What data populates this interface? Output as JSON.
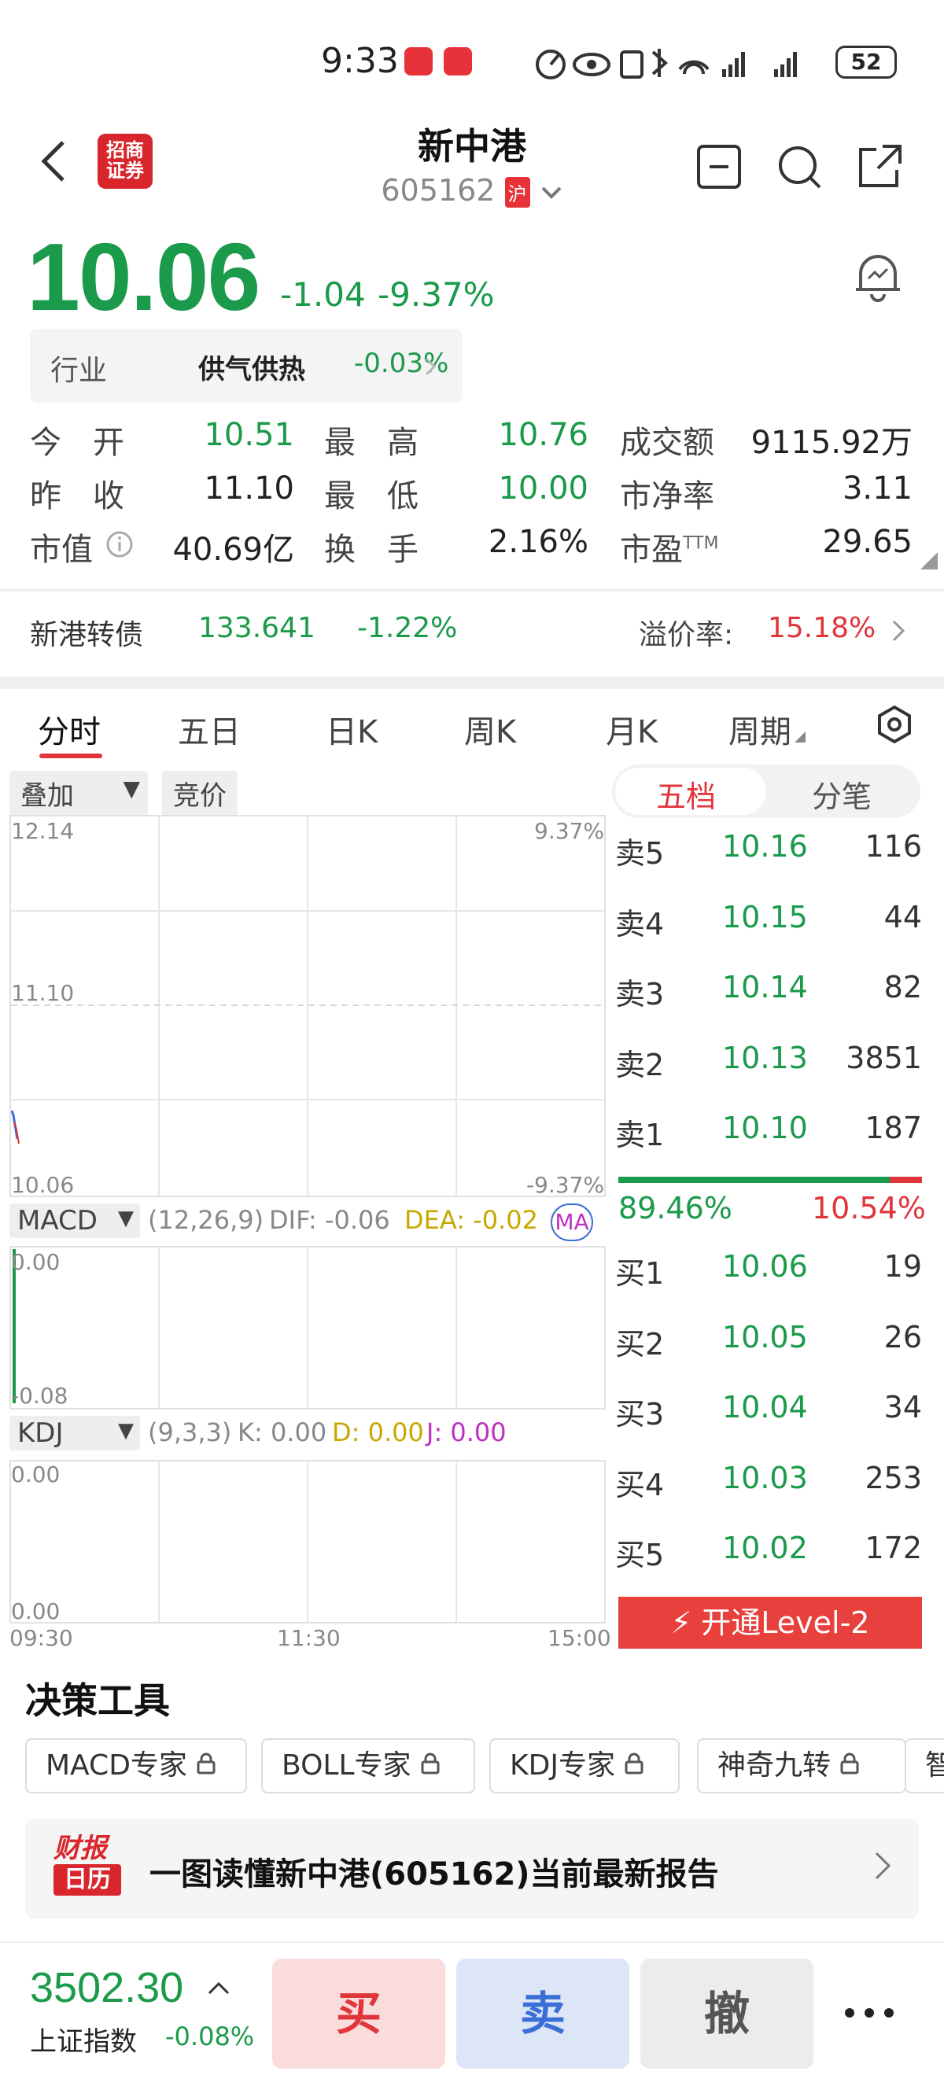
{
  "status_bar": {
    "time": "9:33",
    "battery": "52"
  },
  "header": {
    "title": "新中港",
    "code": "605162",
    "market_badge": "沪",
    "logo_text": "招商证券"
  },
  "quote": {
    "price": "10.06",
    "change": "-1.04",
    "change_pct": "-9.37%",
    "industry_label": "行业",
    "industry_name": "供气供热",
    "industry_change": "-0.03%",
    "rows": [
      [
        {
          "label": "今　开",
          "value": "10.51",
          "color": "#1a9a4a"
        },
        {
          "label": "最　高",
          "value": "10.76",
          "color": "#1a9a4a"
        },
        {
          "label": "成交额",
          "value": "9115.92万",
          "color": "#222222"
        }
      ],
      [
        {
          "label": "昨　收",
          "value": "11.10",
          "color": "#222222"
        },
        {
          "label": "最　低",
          "value": "10.00",
          "color": "#1a9a4a"
        },
        {
          "label": "市净率",
          "value": "3.11",
          "color": "#222222"
        }
      ],
      [
        {
          "label": "市值",
          "value": "40.69亿",
          "color": "#222222"
        },
        {
          "label": "换　手",
          "value": "2.16%",
          "color": "#222222"
        },
        {
          "label": "市盈TTM",
          "value": "29.65",
          "color": "#222222"
        }
      ]
    ]
  },
  "bond": {
    "name": "新港转债",
    "price": "133.641",
    "change": "-1.22%",
    "premium_label": "溢价率:",
    "premium_value": "15.18%"
  },
  "tabs": [
    "分时",
    "五日",
    "日K",
    "周K",
    "月K",
    "周期"
  ],
  "chart_controls": {
    "overlay": "叠加",
    "auction": "竞价"
  },
  "intraday": {
    "y_top": "12.14",
    "y_mid": "11.10",
    "y_bottom": "10.06",
    "pct_top": "9.37%",
    "pct_bottom": "-9.37%",
    "x_start": "09:30",
    "x_mid": "11:30",
    "x_end": "15:00"
  },
  "macd": {
    "label": "MACD",
    "params": "(12,26,9)",
    "dif": "DIF: -0.06",
    "dea": "DEA: -0.02",
    "ma": "MA",
    "y_top": "0.00",
    "y_bottom": "-0.08"
  },
  "kdj": {
    "label": "KDJ",
    "params": "(9,3,3)",
    "k": "K: 0.00",
    "d": "D: 0.00",
    "j": "J: 0.00",
    "y_top": "0.00",
    "y_bottom": "0.00"
  },
  "orderbook": {
    "tab_active": "五档",
    "tab_other": "分笔",
    "asks": [
      {
        "level": "卖5",
        "price": "10.16",
        "vol": "116"
      },
      {
        "level": "卖4",
        "price": "10.15",
        "vol": "44"
      },
      {
        "level": "卖3",
        "price": "10.14",
        "vol": "82"
      },
      {
        "level": "卖2",
        "price": "10.13",
        "vol": "3851"
      },
      {
        "level": "卖1",
        "price": "10.10",
        "vol": "187"
      }
    ],
    "buy_ratio": "89.46%",
    "sell_ratio": "10.54%",
    "buy_fraction": 0.8946,
    "bids": [
      {
        "level": "买1",
        "price": "10.06",
        "vol": "19"
      },
      {
        "level": "买2",
        "price": "10.05",
        "vol": "26"
      },
      {
        "level": "买3",
        "price": "10.04",
        "vol": "34"
      },
      {
        "level": "买4",
        "price": "10.03",
        "vol": "253"
      },
      {
        "level": "买5",
        "price": "10.02",
        "vol": "172"
      }
    ],
    "level2_button": "开通Level-2"
  },
  "tools": {
    "title": "决策工具",
    "items": [
      "MACD专家",
      "BOLL专家",
      "KDJ专家",
      "神奇九转",
      "智"
    ]
  },
  "report": {
    "icon_text_1": "财报",
    "icon_text_2": "日历",
    "text": "一图读懂新中港(605162)当前最新报告"
  },
  "bottom": {
    "index_value": "3502.30",
    "index_name": "上证指数",
    "index_change": "-0.08%",
    "buy": "买",
    "sell": "卖",
    "cancel": "撤"
  },
  "colors": {
    "down": "#1a9a4a",
    "up": "#e0353b"
  }
}
